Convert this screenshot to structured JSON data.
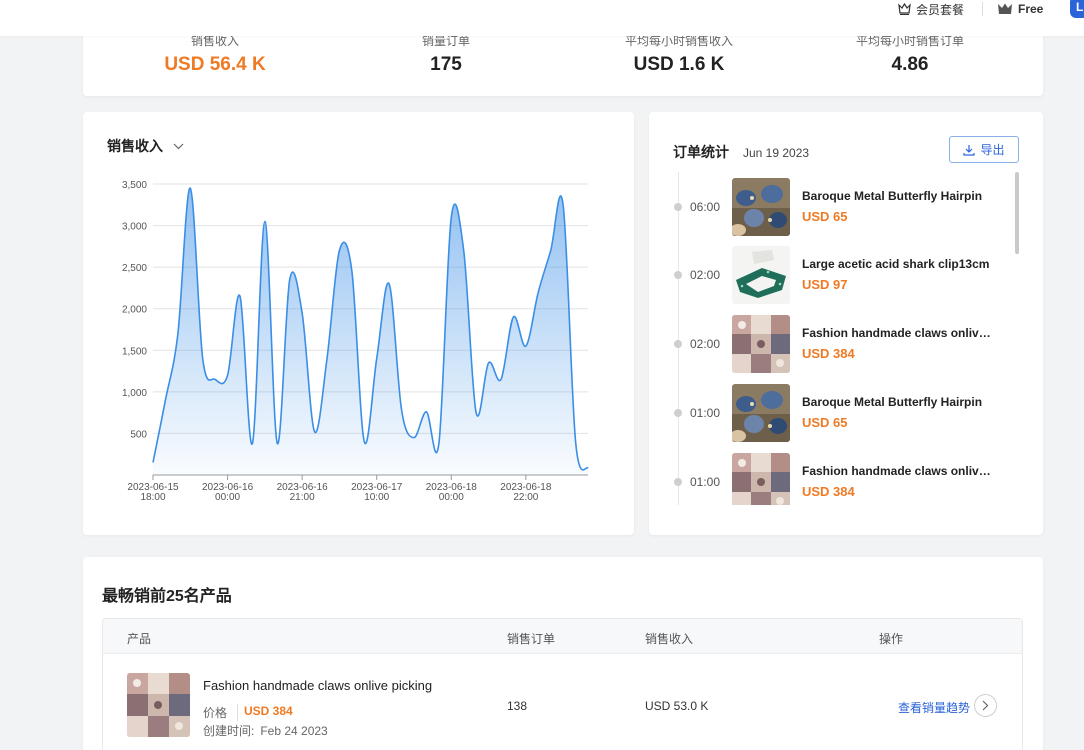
{
  "topbar": {
    "member_label": "会员套餐",
    "plan_label": "Free",
    "avatar_letter": "L"
  },
  "stats": [
    {
      "label": "销售收入",
      "value": "USD 56.4 K"
    },
    {
      "label": "销量订单",
      "value": "175"
    },
    {
      "label": "平均每小时销售收入",
      "value": "USD 1.6 K"
    },
    {
      "label": "平均每小时销售订单",
      "value": "4.86"
    }
  ],
  "chart_card": {
    "title": "销售收入"
  },
  "chart_data": {
    "type": "area",
    "title": "",
    "xlabel": "",
    "ylabel": "",
    "ylim": [
      0,
      3500
    ],
    "yticks": [
      500,
      1000,
      1500,
      2000,
      2500,
      3000,
      3500
    ],
    "ytick_labels": [
      "500",
      "1,000",
      "1,500",
      "2,000",
      "2,500",
      "3,000",
      "3,500"
    ],
    "xticks": [
      {
        "date": "2023-06-15",
        "time": "18:00",
        "index": 0
      },
      {
        "date": "2023-06-16",
        "time": "00:00",
        "index": 6
      },
      {
        "date": "2023-06-16",
        "time": "21:00",
        "index": 12
      },
      {
        "date": "2023-06-17",
        "time": "10:00",
        "index": 18
      },
      {
        "date": "2023-06-18",
        "time": "00:00",
        "index": 24
      },
      {
        "date": "2023-06-18",
        "time": "22:00",
        "index": 30
      }
    ],
    "grid": true,
    "color": "#3a8ee6",
    "values": [
      150,
      900,
      1700,
      3450,
      1400,
      1150,
      1200,
      2150,
      380,
      3050,
      380,
      2350,
      1950,
      520,
      1400,
      2700,
      2450,
      400,
      1400,
      2300,
      780,
      450,
      760,
      380,
      3100,
      2700,
      750,
      1350,
      1150,
      1900,
      1550,
      2200,
      2700,
      3250,
      400,
      80
    ]
  },
  "orders": {
    "title": "订单统计",
    "date": "Jun 19 2023",
    "export_label": "导出",
    "items": [
      {
        "time": "06:00",
        "name": "Baroque Metal Butterfly Hairpin",
        "price": "USD 65",
        "thumb": "butterfly"
      },
      {
        "time": "02:00",
        "name": "Large acetic acid shark clip13cm",
        "price": "USD 97",
        "thumb": "clip"
      },
      {
        "time": "02:00",
        "name": "Fashion handmade claws onlive picking",
        "price": "USD 384",
        "thumb": "claws"
      },
      {
        "time": "01:00",
        "name": "Baroque Metal Butterfly Hairpin",
        "price": "USD 65",
        "thumb": "butterfly"
      },
      {
        "time": "01:00",
        "name": "Fashion handmade claws onlive picking",
        "price": "USD 384",
        "thumb": "claws"
      }
    ]
  },
  "top_products": {
    "title": "最畅销前25名产品",
    "headers": {
      "product": "产品",
      "orders": "销售订单",
      "revenue": "销售收入",
      "action": "操作"
    },
    "rows": [
      {
        "name": "Fashion handmade claws onlive picking",
        "price_label": "价格",
        "price": "USD 384",
        "created_label": "创建时间:",
        "created": "Feb 24 2023",
        "orders": "138",
        "revenue": "USD 53.0 K",
        "action_label": "查看销量趋势"
      }
    ]
  }
}
